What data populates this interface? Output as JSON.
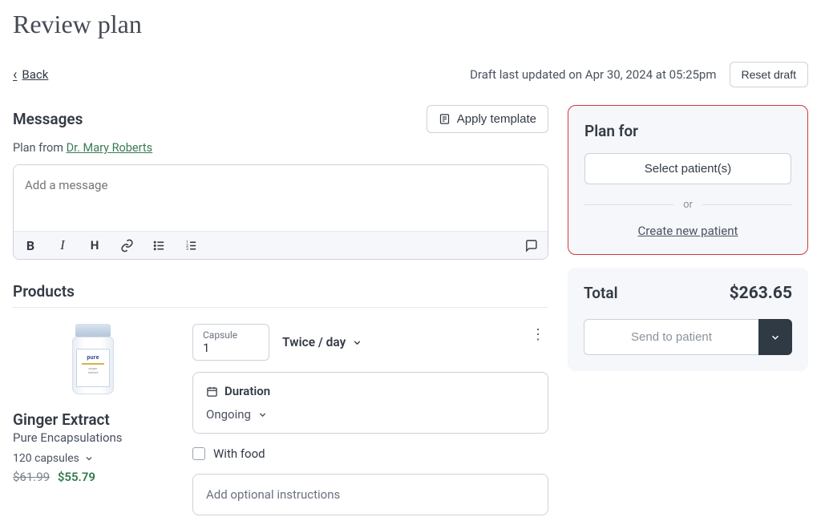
{
  "page_title": "Review plan",
  "back_label": "Back",
  "draft_status": "Draft last updated on Apr 30, 2024 at 05:25pm",
  "reset_label": "Reset draft",
  "messages": {
    "title": "Messages",
    "apply_template_label": "Apply template",
    "plan_from_prefix": "Plan from ",
    "plan_from_name": "Dr. Mary Roberts",
    "placeholder": "Add a message"
  },
  "products": {
    "title": "Products",
    "items": [
      {
        "name": "Ginger Extract",
        "brand": "Pure Encapsulations",
        "size": "120 capsules",
        "price_original": "$61.99",
        "price_discount": "$55.79",
        "dosage_unit": "Capsule",
        "dosage_qty": "1",
        "frequency": "Twice / day",
        "duration_label": "Duration",
        "duration_value": "Ongoing",
        "with_food_label": "With food",
        "optional_instructions_placeholder": "Add optional instructions",
        "bottle_brand": "pure"
      }
    ]
  },
  "plan_for": {
    "title": "Plan for",
    "select_patients_label": "Select patient(s)",
    "or_label": "or",
    "create_patient_label": "Create new patient"
  },
  "totals": {
    "label": "Total",
    "amount": "$263.65",
    "send_label": "Send to patient"
  }
}
